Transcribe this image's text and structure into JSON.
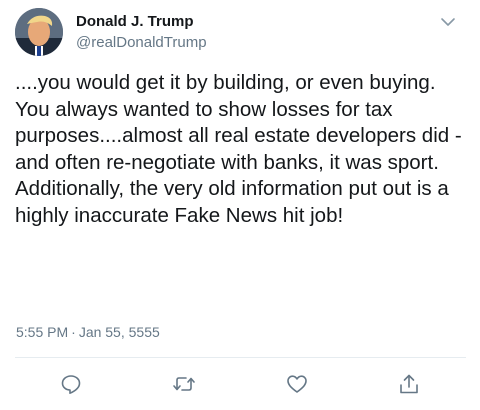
{
  "tweet": {
    "author": {
      "display_name": "Donald J. Trump",
      "handle": "@realDonaldTrump"
    },
    "text": "....you would get it by building, or even buying. You always wanted to show losses for tax purposes....almost all real estate developers did - and often re-negotiate with banks, it was sport. Additionally, the very old information put out is a highly inaccurate Fake News hit job!",
    "time": "5:55 PM",
    "separator": "·",
    "date": "Jan 55, 5555"
  },
  "actions": {
    "reply_icon": "reply-icon",
    "retweet_icon": "retweet-icon",
    "like_icon": "heart-icon",
    "share_icon": "share-icon"
  },
  "colors": {
    "primary_text": "#14171a",
    "secondary_text": "#657786",
    "divider": "#e6ecf0"
  }
}
